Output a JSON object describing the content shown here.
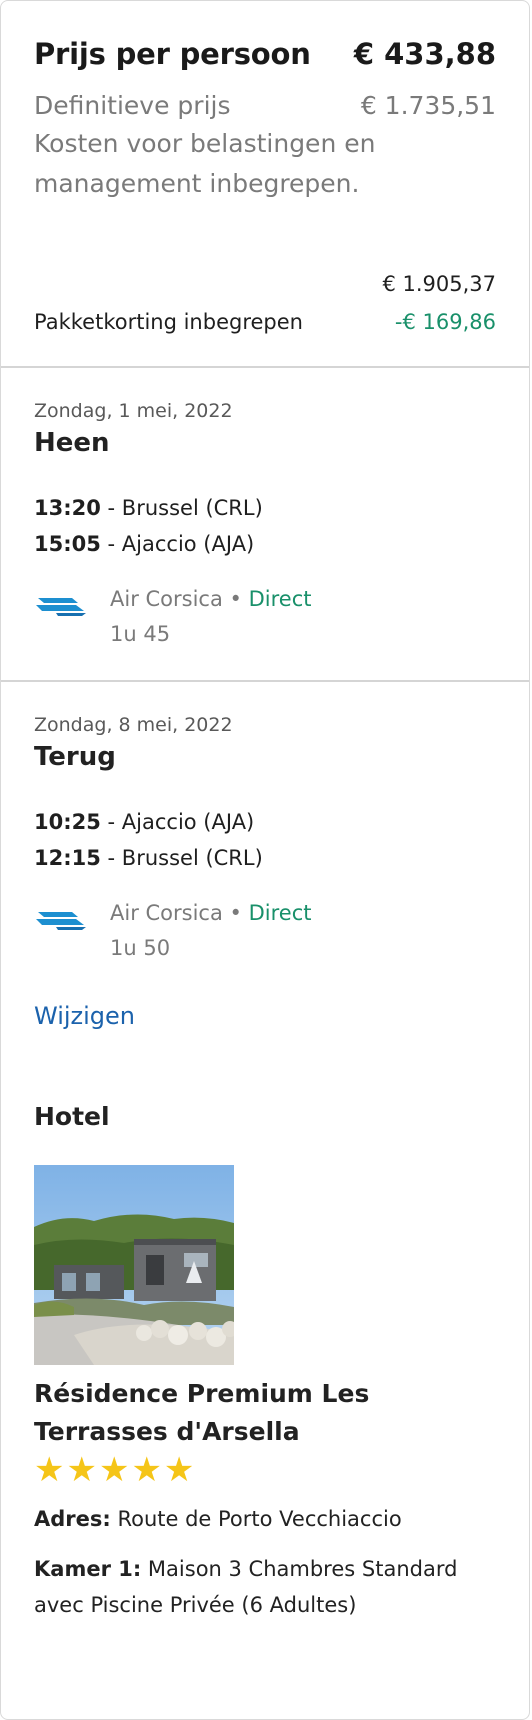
{
  "price": {
    "per_person_label": "Prijs per persoon",
    "per_person_value": "€ 433,88",
    "final_label": "Definitieve prijs",
    "final_value": "€ 1.735,51",
    "tax_note": "Kosten voor belastingen en management inbegrepen.",
    "original_value": "€ 1.905,37",
    "discount_label": "Pakketkorting inbegrepen",
    "discount_value": "-€ 169,86"
  },
  "outbound": {
    "date": "Zondag, 1 mei, 2022",
    "title": "Heen",
    "dep_time": "13:20",
    "dep_place": " - Brussel (CRL)",
    "arr_time": "15:05",
    "arr_place": " - Ajaccio (AJA)",
    "airline": "Air Corsica",
    "separator": " • ",
    "stops": "Direct",
    "duration": "1u 45",
    "logo_icon": "air-corsica-logo"
  },
  "inbound": {
    "date": "Zondag, 8 mei, 2022",
    "title": "Terug",
    "dep_time": "10:25",
    "dep_place": " - Ajaccio (AJA)",
    "arr_time": "12:15",
    "arr_place": " - Brussel (CRL)",
    "airline": "Air Corsica",
    "separator": " • ",
    "stops": "Direct",
    "duration": "1u 50",
    "logo_icon": "air-corsica-logo"
  },
  "change_link": "Wijzigen",
  "hotel": {
    "heading": "Hotel",
    "name": "Résidence Premium Les Terrasses d'Arsella",
    "stars": "★★★★★",
    "star_count": 5,
    "address_label": "Adres:",
    "address_value": " Route de Porto Vecchiaccio",
    "room_label": "Kamer 1:",
    "room_value": " Maison 3 Chambres Standard avec Piscine Privée (6 Adultes)"
  },
  "colors": {
    "green": "#19906a",
    "link": "#1b62ac",
    "star": "#f5c518",
    "muted": "#7a7a7a"
  }
}
